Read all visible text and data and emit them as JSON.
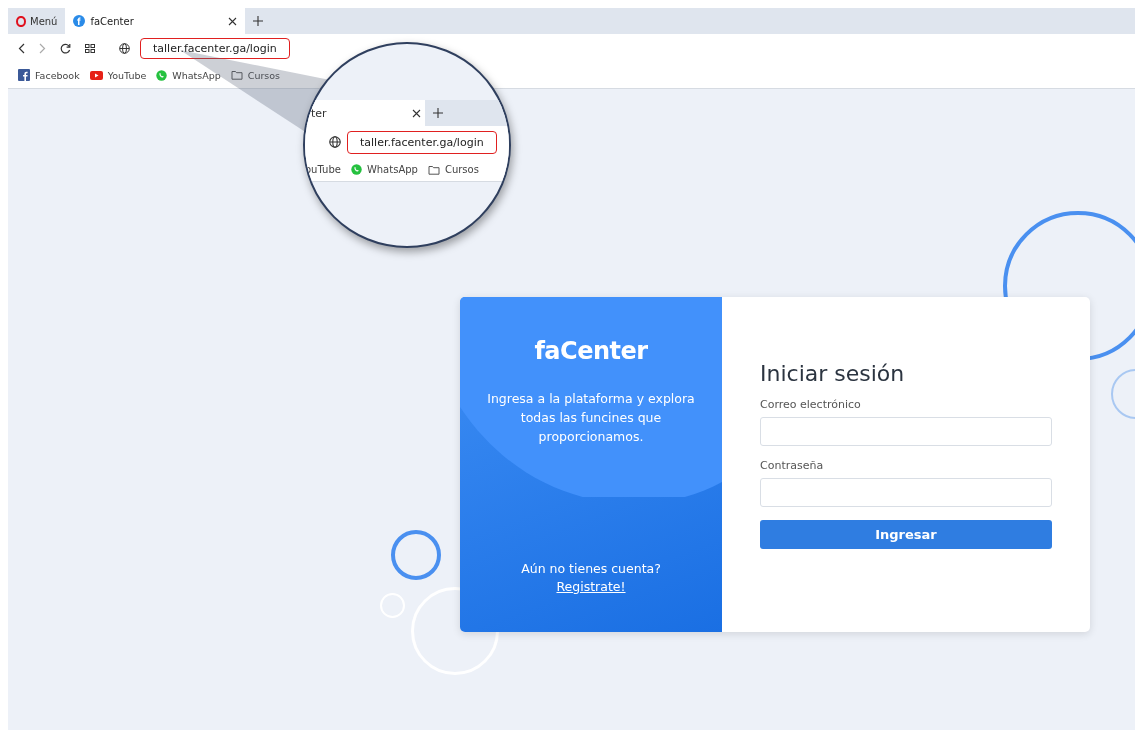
{
  "browser": {
    "menu_label": "Menú",
    "tabs": [
      {
        "title": "faCenter",
        "selected": true
      }
    ],
    "url": "taller.facenter.ga/login",
    "bookmarks": [
      {
        "kind": "facebook",
        "label": "Facebook"
      },
      {
        "kind": "youtube",
        "label": "YouTube"
      },
      {
        "kind": "whatsapp",
        "label": "WhatsApp"
      },
      {
        "kind": "folder",
        "label": "Cursos"
      }
    ]
  },
  "magnifier": {
    "tab_title": "ter",
    "url": "taller.facenter.ga/login",
    "bookmarks": [
      {
        "label": "ouTube"
      },
      {
        "kind": "whatsapp",
        "label": "WhatsApp"
      },
      {
        "kind": "folder",
        "label": "Cursos"
      }
    ]
  },
  "login": {
    "brand": "faCenter",
    "tagline": "Ingresa a la plataforma y explora todas las funcines que proporcionamos.",
    "signup_prompt": "Aún no tienes cuenta?",
    "signup_link": "Registrate!",
    "title": "Iniciar sesión",
    "fields": [
      {
        "label": "Correo electrónico"
      },
      {
        "label": "Contraseña"
      }
    ],
    "submit": "Ingresar"
  }
}
